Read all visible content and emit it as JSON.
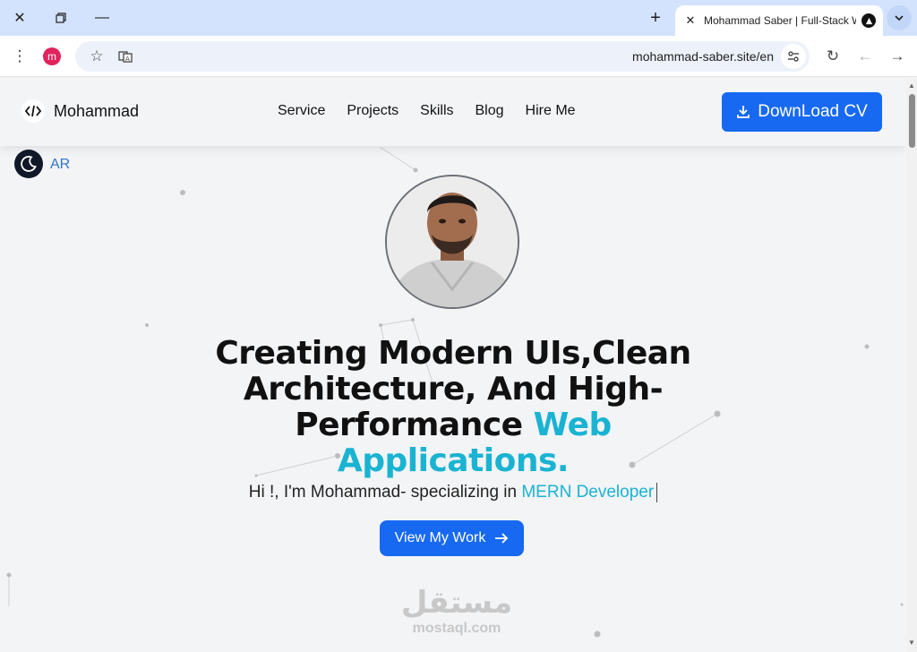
{
  "browser": {
    "tab_title": "Mohammad Saber | Full-Stack Web",
    "url": "mohammad-saber.site/en",
    "profile_initial": "m"
  },
  "site": {
    "brand_name": "Mohammad",
    "nav_items": [
      "Service",
      "Projects",
      "Skills",
      "Blog",
      "Hire Me"
    ],
    "download_cv": "DownLoad CV",
    "language_toggle": "AR",
    "headline_plain": "Creating Modern UIs,Clean Architecture, And High-Performance",
    "headline_accent": "Web Applications.",
    "intro_text": "Hi !, I'm Mohammad- specializing in",
    "intro_role": "MERN Developer",
    "cta_label": "View My Work",
    "watermark_arabic": "مستقل",
    "watermark_latin": "mostaql.com"
  },
  "colors": {
    "accent": "#1ab3d2",
    "primary_button": "#1769f2",
    "page_background": "#f3f4f6"
  }
}
